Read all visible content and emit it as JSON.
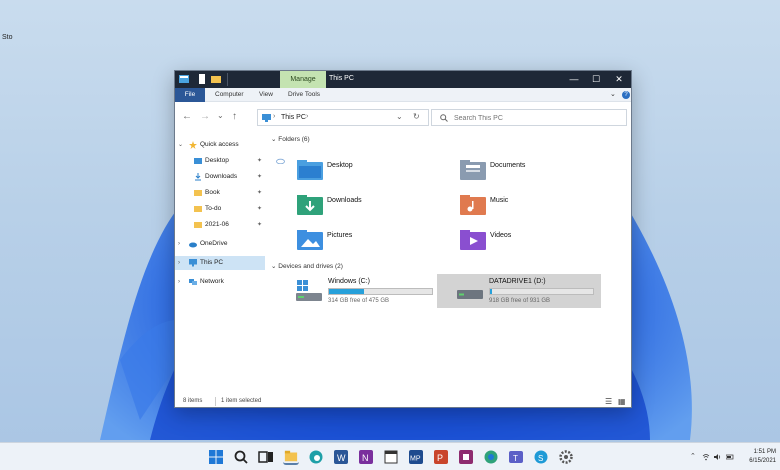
{
  "desktop": {
    "icon_label": "Sto"
  },
  "window": {
    "title": "This PC",
    "context_tab": "Manage",
    "controls": [
      "—",
      "☐",
      "✕"
    ],
    "ribbon_tabs": [
      "File",
      "Computer",
      "View",
      "Drive Tools"
    ]
  },
  "address": {
    "nav_back": "←",
    "nav_forward": "→",
    "nav_recent": "⌄",
    "nav_up": "↑",
    "path": "This PC",
    "separator": "›",
    "search_placeholder": "Search This PC"
  },
  "sidebar": {
    "items": [
      {
        "label": "Quick access"
      },
      {
        "label": "Desktop"
      },
      {
        "label": "Downloads"
      },
      {
        "label": "Book"
      },
      {
        "label": "To-do"
      },
      {
        "label": "2021-06"
      },
      {
        "label": "OneDrive"
      },
      {
        "label": "This PC"
      },
      {
        "label": "Network"
      }
    ]
  },
  "folders": {
    "header": "Folders (6)",
    "items": [
      {
        "label": "Desktop"
      },
      {
        "label": "Documents"
      },
      {
        "label": "Downloads"
      },
      {
        "label": "Music"
      },
      {
        "label": "Pictures"
      },
      {
        "label": "Videos"
      }
    ]
  },
  "drives": {
    "header": "Devices and drives (2)",
    "items": [
      {
        "name": "Windows (C:)",
        "free": "314 GB free of 475 GB",
        "used_fraction": 0.34
      },
      {
        "name": "DATADRIVE1 (D:)",
        "free": "918 GB free of 931 GB",
        "used_fraction": 0.015
      }
    ]
  },
  "status": {
    "items": "8 items",
    "selected": "1 item selected"
  },
  "taskbar": {
    "time": "1:51 PM",
    "date": "6/15/2021"
  },
  "colors": {
    "accent": "#26a0da",
    "titlebar": "#1e2837",
    "manage_tab": "#c4e3b1",
    "selection": "#cde3f5",
    "drive_selected": "#d3d3d3"
  }
}
